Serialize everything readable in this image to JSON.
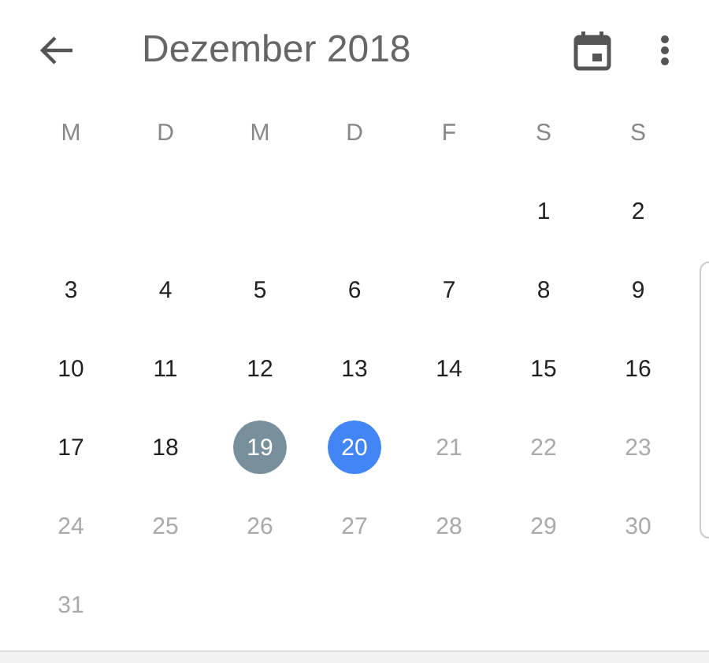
{
  "header": {
    "title": "Dezember 2018"
  },
  "weekdays": [
    "M",
    "D",
    "M",
    "D",
    "F",
    "S",
    "S"
  ],
  "weeks": [
    [
      {
        "day": "1",
        "selected": false,
        "highlighted": false,
        "disabled": false
      },
      {
        "day": "2",
        "selected": false,
        "highlighted": false,
        "disabled": false
      }
    ],
    [
      {
        "day": "3",
        "selected": false,
        "highlighted": false,
        "disabled": false
      },
      {
        "day": "4",
        "selected": false,
        "highlighted": false,
        "disabled": false
      },
      {
        "day": "5",
        "selected": false,
        "highlighted": false,
        "disabled": false
      },
      {
        "day": "6",
        "selected": false,
        "highlighted": false,
        "disabled": false
      },
      {
        "day": "7",
        "selected": false,
        "highlighted": false,
        "disabled": false
      },
      {
        "day": "8",
        "selected": false,
        "highlighted": false,
        "disabled": false
      },
      {
        "day": "9",
        "selected": false,
        "highlighted": false,
        "disabled": false
      }
    ],
    [
      {
        "day": "10",
        "selected": false,
        "highlighted": false,
        "disabled": false
      },
      {
        "day": "11",
        "selected": false,
        "highlighted": false,
        "disabled": false
      },
      {
        "day": "12",
        "selected": false,
        "highlighted": false,
        "disabled": false
      },
      {
        "day": "13",
        "selected": false,
        "highlighted": false,
        "disabled": false
      },
      {
        "day": "14",
        "selected": false,
        "highlighted": false,
        "disabled": false
      },
      {
        "day": "15",
        "selected": false,
        "highlighted": false,
        "disabled": false
      },
      {
        "day": "16",
        "selected": false,
        "highlighted": false,
        "disabled": false
      }
    ],
    [
      {
        "day": "17",
        "selected": false,
        "highlighted": false,
        "disabled": false
      },
      {
        "day": "18",
        "selected": false,
        "highlighted": false,
        "disabled": false
      },
      {
        "day": "19",
        "selected": false,
        "highlighted": true,
        "disabled": false
      },
      {
        "day": "20",
        "selected": true,
        "highlighted": false,
        "disabled": false
      },
      {
        "day": "21",
        "selected": false,
        "highlighted": false,
        "disabled": true
      },
      {
        "day": "22",
        "selected": false,
        "highlighted": false,
        "disabled": true
      },
      {
        "day": "23",
        "selected": false,
        "highlighted": false,
        "disabled": true
      }
    ],
    [
      {
        "day": "24",
        "selected": false,
        "highlighted": false,
        "disabled": true
      },
      {
        "day": "25",
        "selected": false,
        "highlighted": false,
        "disabled": true
      },
      {
        "day": "26",
        "selected": false,
        "highlighted": false,
        "disabled": true
      },
      {
        "day": "27",
        "selected": false,
        "highlighted": false,
        "disabled": true
      },
      {
        "day": "28",
        "selected": false,
        "highlighted": false,
        "disabled": true
      },
      {
        "day": "29",
        "selected": false,
        "highlighted": false,
        "disabled": true
      },
      {
        "day": "30",
        "selected": false,
        "highlighted": false,
        "disabled": true
      }
    ],
    [
      {
        "day": "31",
        "selected": false,
        "highlighted": false,
        "disabled": true
      }
    ]
  ]
}
